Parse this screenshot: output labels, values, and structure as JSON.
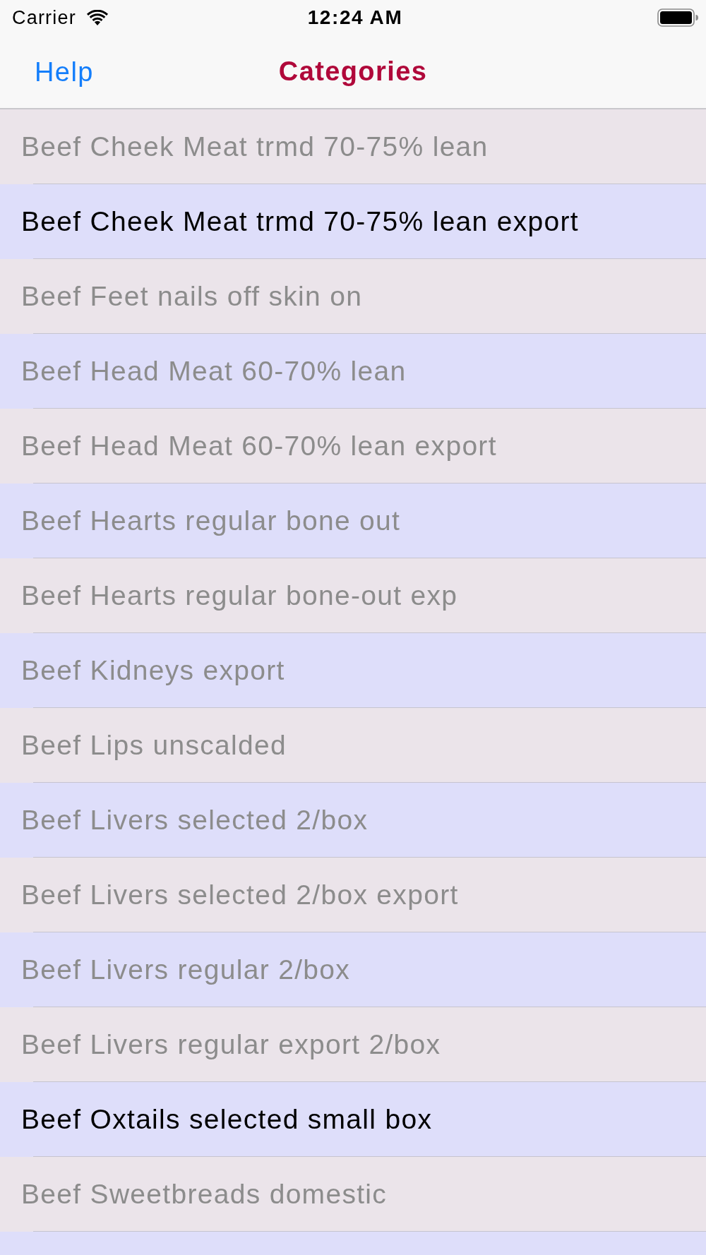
{
  "status_bar": {
    "carrier": "Carrier",
    "time": "12:24 AM"
  },
  "nav_bar": {
    "left_button": "Help",
    "title": "Categories"
  },
  "categories": [
    {
      "name": "Beef Cheek Meat trmd 70-75% lean",
      "selected": false
    },
    {
      "name": "Beef Cheek Meat trmd 70-75% lean export",
      "selected": true
    },
    {
      "name": "Beef Feet nails off skin on",
      "selected": false
    },
    {
      "name": "Beef Head Meat 60-70% lean",
      "selected": false
    },
    {
      "name": "Beef Head Meat 60-70% lean export",
      "selected": false
    },
    {
      "name": "Beef Hearts regular bone out",
      "selected": false
    },
    {
      "name": "Beef Hearts regular bone-out exp",
      "selected": false
    },
    {
      "name": "Beef Kidneys export",
      "selected": false
    },
    {
      "name": "Beef Lips unscalded",
      "selected": false
    },
    {
      "name": "Beef Livers selected 2/box",
      "selected": false
    },
    {
      "name": "Beef Livers selected 2/box export",
      "selected": false
    },
    {
      "name": "Beef Livers regular 2/box",
      "selected": false
    },
    {
      "name": "Beef Livers regular export 2/box",
      "selected": false
    },
    {
      "name": "Beef Oxtails selected small box",
      "selected": true
    },
    {
      "name": "Beef Sweetbreads domestic",
      "selected": false
    }
  ]
}
